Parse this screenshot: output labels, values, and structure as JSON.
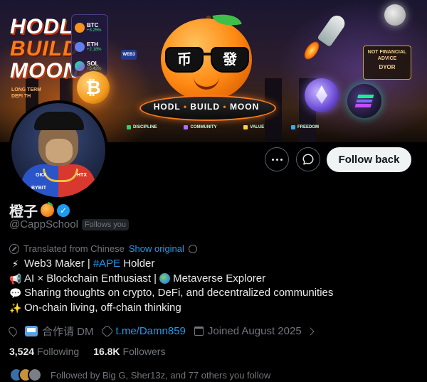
{
  "banner": {
    "hodl_lines": [
      "HODL",
      "BUILD",
      "MOON"
    ],
    "long_term": [
      "LONG TERM",
      "DEFI TH"
    ],
    "tickers": [
      {
        "symbol": "BTC",
        "change": "+3.25%",
        "color": "#f7931a"
      },
      {
        "symbol": "ETH",
        "change": "+2.18%",
        "color": "#627eea"
      },
      {
        "symbol": "SOL",
        "change": "+5.42%",
        "color": "#14f195"
      }
    ],
    "btc_coin": "₿",
    "web3_chip": "WEB3",
    "lens_left": "币",
    "lens_right": "發",
    "pedestal": {
      "hodl": "HODL",
      "build": "BUILD",
      "moon": "MOON",
      "sep": "•"
    },
    "values": [
      {
        "label": "DISCIPLINE",
        "color": "#2fd36a"
      },
      {
        "label": "COMMUNITY",
        "color": "#b76cff"
      },
      {
        "label": "VALUE",
        "color": "#ffd23a"
      },
      {
        "label": "FREEDOM",
        "color": "#39a8ff"
      }
    ],
    "nfa_text": "NOT FINANCIAL ADVICE",
    "dyor": "DYOR"
  },
  "avatar_chips": [
    "BYBIT",
    "OKX",
    "HTX"
  ],
  "profile": {
    "display_name": "橙子",
    "verified_mark": "✓",
    "handle": "@CappSchool",
    "follows_you": "Follows you"
  },
  "actions": {
    "more_label": "More",
    "message_label": "Message",
    "follow_back": "Follow back"
  },
  "translation": {
    "translated_from": "Translated from Chinese",
    "show_original": "Show original"
  },
  "bio": {
    "line1_emoji": "⚡",
    "line1_text": "Web3 Maker |",
    "line1_hashtag": "#APE",
    "line1_tail": "Holder",
    "line2_emoji": "📢",
    "line2_text": "AI × Blockchain Enthusiast |",
    "line2_tail": "Metaverse Explorer",
    "line3_emoji": "💬",
    "line3_text": "Sharing thoughts on crypto, DeFi, and decentralized communities",
    "line4_emoji": "✨",
    "line4_text": "On-chain living, off-chain thinking"
  },
  "meta": {
    "dm_text": "合作请 DM",
    "link": "t.me/Damn859",
    "joined": "Joined August 2025"
  },
  "counts": {
    "following_value": "3,524",
    "following_label": "Following",
    "followers_value": "16.8K",
    "followers_label": "Followers"
  },
  "followed_by": {
    "text": "Followed by Big G, Sher13z, and 77 others you follow",
    "face_colors": [
      "#3a6ea8",
      "#c9913a",
      "#7a7f86"
    ]
  },
  "colors": {
    "accent": "#1d9bf0",
    "muted": "#71767b",
    "text": "#e7e9ea",
    "background": "#000000"
  }
}
